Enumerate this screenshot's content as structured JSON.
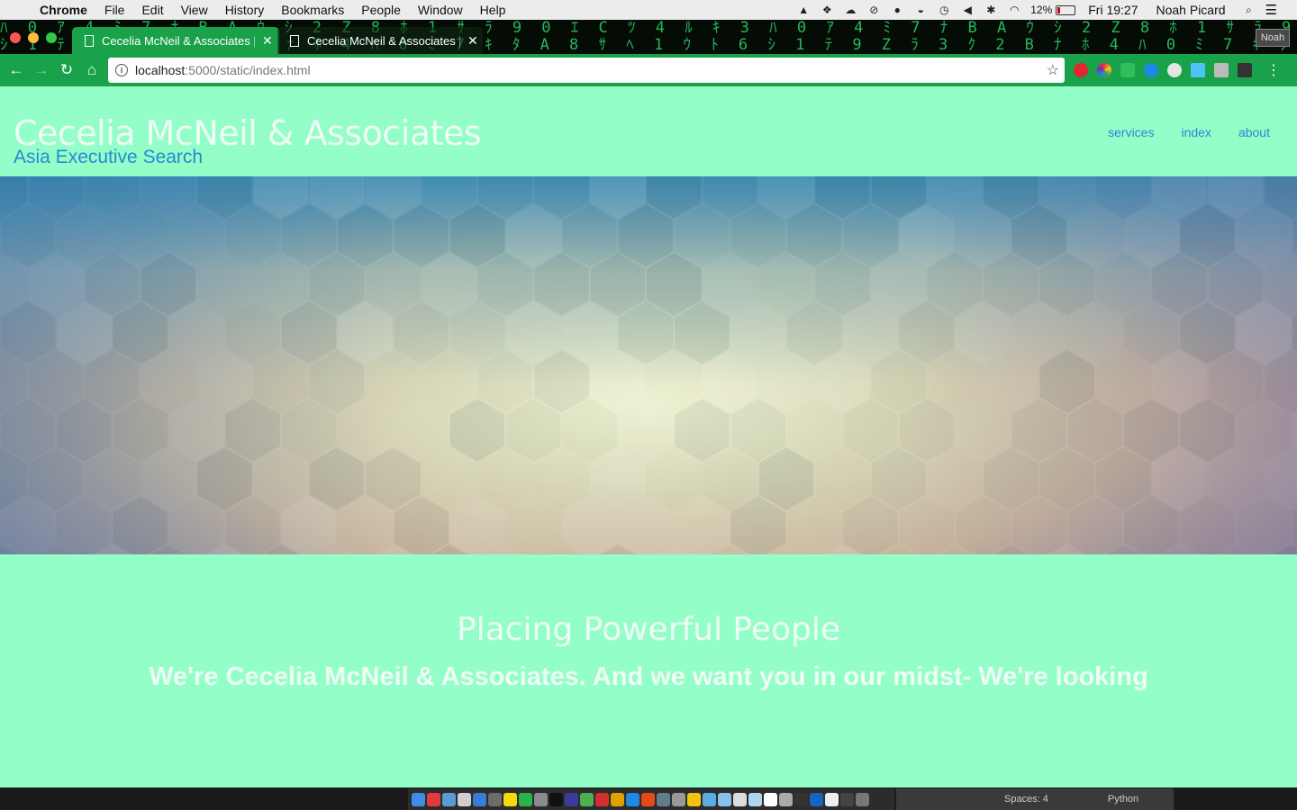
{
  "menubar": {
    "app_name": "Chrome",
    "items": [
      "File",
      "Edit",
      "View",
      "History",
      "Bookmarks",
      "People",
      "Window",
      "Help"
    ],
    "battery_percent": "12%",
    "clock": "Fri 19:27",
    "user": "Noah Picard"
  },
  "browser": {
    "tabs": [
      {
        "title": "Cecelia McNeil & Associates | A"
      },
      {
        "title": "Cecelia McNeil & Associates | A"
      }
    ],
    "profile_label": "Noah",
    "url_host": "localhost",
    "url_path": ":5000/static/index.html",
    "colors": {
      "theme": "#1aa24a",
      "page_background": "#93fec7"
    }
  },
  "site": {
    "title": "Cecelia McNeil & Associates",
    "subtitle": "Asia Executive Search",
    "nav": [
      "services",
      "index",
      "about"
    ],
    "tagline": "Placing Powerful People",
    "intro": "We're Cecelia McNeil & Associates. And we want you in our midst- We're looking"
  },
  "statusbar": {
    "spaces": "Spaces: 4",
    "language": "Python"
  }
}
